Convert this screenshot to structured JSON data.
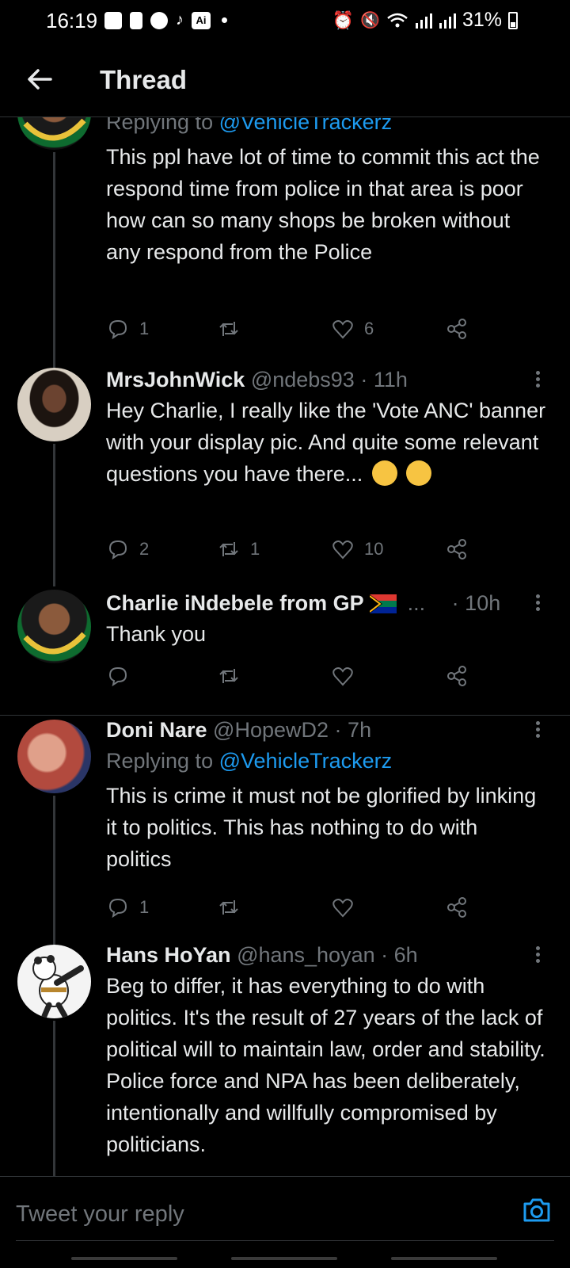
{
  "status_bar": {
    "time": "16:19",
    "battery": "31%",
    "ai_badge": "Ai"
  },
  "header": {
    "title": "Thread"
  },
  "tweets": [
    {
      "replying_prefix": "Replying to",
      "replying_mention": "@VehicleTrackerz",
      "text": "This ppl have lot of time to commit this act the respond time from police in that area is poor how can so many shops be broken without any respond from the Police",
      "reply_count": "1",
      "retweet_count": "",
      "like_count": "6"
    },
    {
      "name": "MrsJohnWick",
      "handle": "@ndebs93",
      "time": "11h",
      "text": "Hey Charlie, I really like the 'Vote ANC' banner with your display pic. And quite some relevant questions you have there...",
      "emojis": [
        "woozy-face",
        "thinking-face"
      ],
      "reply_count": "2",
      "retweet_count": "1",
      "like_count": "10"
    },
    {
      "name": "Charlie iNdebele from GP",
      "name_suffix": "...",
      "handle": "",
      "time": "10h",
      "text": "Thank you",
      "reply_count": "",
      "retweet_count": "",
      "like_count": ""
    },
    {
      "name": "Doni Nare",
      "handle": "@HopewD2",
      "time": "7h",
      "replying_prefix": "Replying to",
      "replying_mention": "@VehicleTrackerz",
      "text": "This is crime it must not be glorified by linking it to politics. This has nothing to do with politics",
      "reply_count": "1",
      "retweet_count": "",
      "like_count": ""
    },
    {
      "name": "Hans HoYan",
      "handle": "@hans_hoyan",
      "time": "6h",
      "text": "Beg to differ, it has everything to do with politics. It's the result of 27 years of the lack of political will to maintain law, order and stability. Police force and NPA has been deliberately, intentionally and willfully compromised by politicians."
    }
  ],
  "separator": "·",
  "composer": {
    "placeholder": "Tweet your reply"
  },
  "colors": {
    "background": "#000000",
    "accent": "#1d9bf0",
    "muted": "#71767b",
    "text": "#e7e9ea"
  }
}
